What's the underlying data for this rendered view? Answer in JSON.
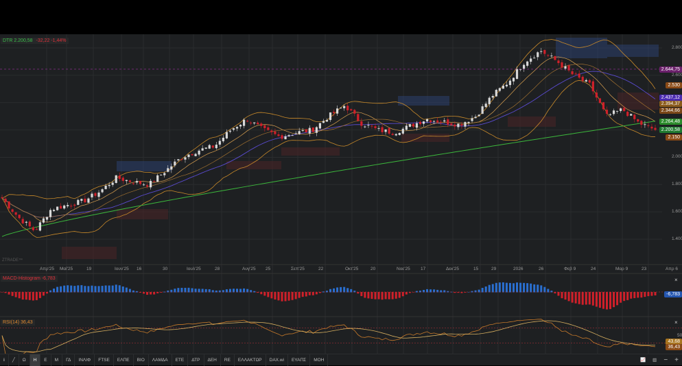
{
  "legend": {
    "symbol": "DTR 2.200,58",
    "change": "-32,22 -1,44%"
  },
  "watermark": "ZTRADE™",
  "price_tags": [
    {
      "text": "2.644,75",
      "color": "#6b1f6b",
      "value": 2644.75
    },
    {
      "text": "2.530",
      "color": "#8a4a16",
      "value": 2530
    },
    {
      "text": "2.437,12",
      "color": "#4b2bb0",
      "value": 2437.12
    },
    {
      "text": "2.394,37",
      "color": "#8a5a1a",
      "value": 2394.37
    },
    {
      "text": "2.344,66",
      "color": "#7a4616",
      "value": 2344.66
    },
    {
      "text": "2.264,48",
      "color": "#2a8a2a",
      "value": 2264.48
    },
    {
      "text": "2.200,58",
      "color": "#1f7a2f",
      "value": 2200.58
    },
    {
      "text": "2.150",
      "color": "#8a4a16",
      "value": 2150
    }
  ],
  "macd": {
    "label": "MACD-Histogram",
    "value": "-6,783",
    "tag": "-6,783",
    "close": "×"
  },
  "rsi": {
    "label": "RSI(14)",
    "value": "36,43",
    "level": "50",
    "tag1": "43,68",
    "tag2": "36,43",
    "close": "×"
  },
  "toolbar": {
    "items": [
      "Ω",
      "Η",
      "Ε",
      "Μ",
      "ΓΔ",
      "ΙΝΛΙΦ",
      "FTSE",
      "ΕΛΠΕ",
      "ΒΙΟ",
      "ΛΑΜΔΑ",
      "ΕΤΕ",
      "ΔΤΡ",
      "ΔΕΗ",
      "RE",
      "ΕΛΛΑΚΤΩΡ",
      "DAX.wi",
      "ΕΥΑΠΣ",
      "ΜΟΗ"
    ],
    "active": "Η",
    "minus": "−",
    "plus": "+"
  },
  "chart_data": {
    "type": "candlestick",
    "title": "DTR",
    "y_ticks": [
      2800,
      2600,
      2400,
      2200,
      2000,
      1800,
      1600,
      1400
    ],
    "y_tick_labels": [
      "2.800",
      "2.600",
      "2.400",
      "2.200",
      "2.000",
      "1.800",
      "1.600",
      "1.400"
    ],
    "ylim": [
      1340,
      2880
    ],
    "x_tick_labels": [
      "Απρ'25",
      "Μαϊ'25",
      "19",
      "Ιουν'25",
      "16",
      "30",
      "Ιουλ'25",
      "28",
      "Αυγ'25",
      "25",
      "Σεπ'25",
      "22",
      "Οκτ'25",
      "20",
      "Νοε'25",
      "17",
      "Δεκ'25",
      "15",
      "29",
      "2026",
      "26",
      "Φεβ 9",
      "24",
      "Μαρ 9",
      "23",
      "Απρ 6"
    ],
    "close_path": [
      1700,
      1560,
      1460,
      1620,
      1650,
      1680,
      1750,
      1850,
      1820,
      1800,
      1900,
      2000,
      2050,
      2080,
      2200,
      2280,
      2200,
      2150,
      2180,
      2200,
      2300,
      2380,
      2250,
      2200,
      2180,
      2230,
      2280,
      2260,
      2240,
      2300,
      2450,
      2550,
      2700,
      2780,
      2700,
      2600,
      2530,
      2300,
      2350,
      2250,
      2200
    ],
    "ma200_range": [
      1420,
      2264.48
    ],
    "last": 2200.58
  }
}
